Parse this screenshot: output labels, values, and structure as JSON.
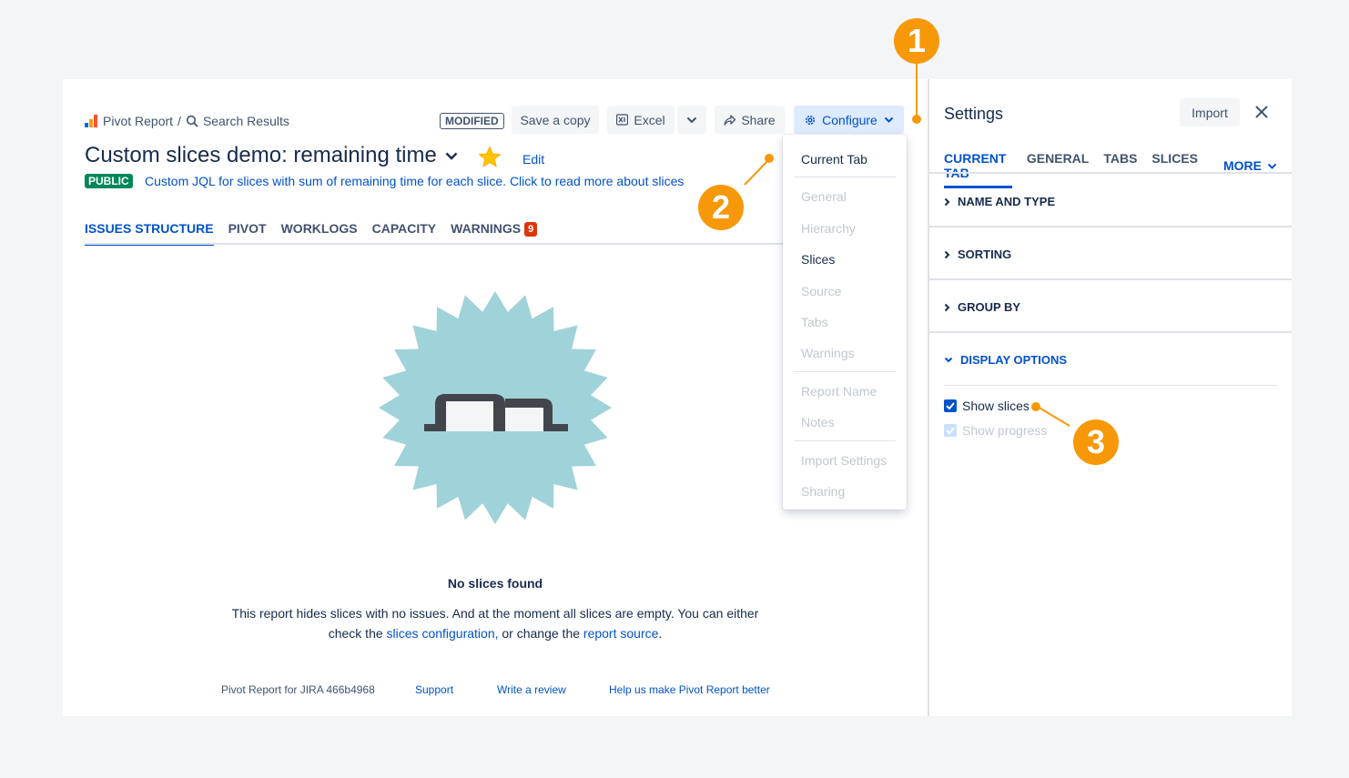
{
  "breadcrumb": {
    "app": "Pivot Report",
    "separator": "/",
    "page": "Search Results"
  },
  "toolbar": {
    "modified": "MODIFIED",
    "save_copy": "Save a copy",
    "excel": "Excel",
    "share": "Share",
    "configure": "Configure"
  },
  "report": {
    "title": "Custom slices demo: remaining time",
    "edit": "Edit",
    "visibility": "PUBLIC",
    "description": "Custom JQL for slices with sum of remaining time for each slice. Click to read more about slices"
  },
  "tabs": [
    {
      "label": "ISSUES STRUCTURE"
    },
    {
      "label": "PIVOT"
    },
    {
      "label": "WORKLOGS"
    },
    {
      "label": "CAPACITY"
    },
    {
      "label": "WARNINGS",
      "badge": "9"
    }
  ],
  "empty": {
    "title": "No slices found",
    "text_1": "This report hides slices with no issues. And at the moment all slices are empty. You can either",
    "text_2": "check the",
    "link_config": "slices configuration,",
    "text_3": "or change the",
    "link_source": "report source",
    "text_4": "."
  },
  "footer": {
    "version": "Pivot Report for JIRA 466b4968",
    "support": "Support",
    "review": "Write a review",
    "help": "Help us make Pivot Report better"
  },
  "dropdown": {
    "current_tab": "Current Tab",
    "general": "General",
    "hierarchy": "Hierarchy",
    "slices": "Slices",
    "source": "Source",
    "tabs": "Tabs",
    "warnings": "Warnings",
    "report_name": "Report Name",
    "notes": "Notes",
    "import_settings": "Import Settings",
    "sharing": "Sharing"
  },
  "settings": {
    "title": "Settings",
    "import": "Import",
    "tabs": [
      "CURRENT TAB",
      "GENERAL",
      "TABS",
      "SLICES"
    ],
    "more": "MORE",
    "sections": [
      "NAME AND TYPE",
      "SORTING",
      "GROUP BY",
      "DISPLAY OPTIONS"
    ],
    "show_slices": "Show slices",
    "show_progress": "Show progress"
  },
  "callouts": [
    "1",
    "2",
    "3"
  ],
  "colors": {
    "accent": "#0052cc",
    "callout": "#f79808",
    "public": "#00875a",
    "warning": "#de350b",
    "illustration": "#a0d2d9"
  }
}
